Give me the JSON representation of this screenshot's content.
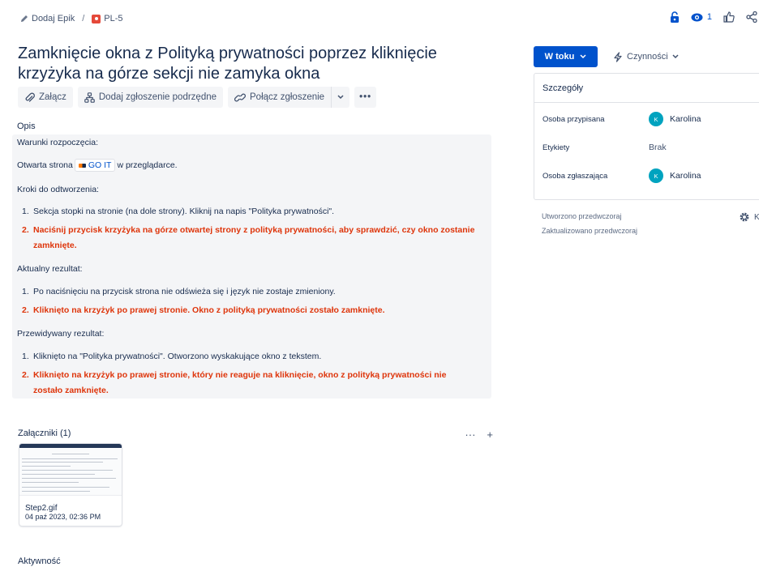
{
  "breadcrumb": {
    "epic_label": "Dodaj Epik",
    "separator": "/",
    "issue_key": "PL-5"
  },
  "header": {
    "watch_count": "1"
  },
  "issue": {
    "title": "Zamknięcie okna z Polityką prywatności poprzez kliknięcie krzyżyka na górze sekcji nie zamyka okna"
  },
  "toolbar": {
    "attach": "Załącz",
    "add_child": "Dodaj zgłoszenie podrzędne",
    "link_issue": "Połącz zgłoszenie",
    "more": "•••"
  },
  "description": {
    "label": "Opis",
    "preconditions_heading": "Warunki rozpoczęcia:",
    "open_page_before": "Otwarta strona",
    "goit_link": "GO IT",
    "open_page_after": "w przeglądarce.",
    "steps_heading": "Kroki do odtworzenia:",
    "steps": [
      {
        "num": "1.",
        "text": "Sekcja stopki na stronie (na dole strony). Kliknij na napis \"Polityka prywatności\"."
      },
      {
        "num": "2.",
        "text": "Naciśnij przycisk krzyżyka na górze otwartej strony z polityką prywatności, aby sprawdzić, czy okno zostanie zamknięte."
      }
    ],
    "actual_heading": "Aktualny rezultat:",
    "actual": [
      {
        "num": "1.",
        "text": "Po naciśnięciu na przycisk strona nie odświeża się i język nie zostaje zmieniony."
      },
      {
        "num": "2.",
        "text": "Kliknięto na krzyżyk po prawej stronie. Okno z polityką prywatności zostało zamknięte."
      }
    ],
    "expected_heading": "Przewidywany rezultat:",
    "expected": [
      {
        "num": "1.",
        "text": "Kliknięto na \"Polityka prywatności\". Otworzono wyskakujące okno z tekstem."
      },
      {
        "num": "2.",
        "text": "Kliknięto na krzyżyk po prawej stronie, który nie reaguje na kliknięcie, okno z polityką prywatności nie zostało zamknięte."
      }
    ]
  },
  "attachments": {
    "label": "Załączniki (1)",
    "more": "···",
    "add": "+",
    "file_name": "Step2.gif",
    "file_date": "04 paź 2023, 02:36 PM"
  },
  "activity": {
    "label": "Aktywność"
  },
  "sidebar": {
    "status": "W toku",
    "actions": "Czynności",
    "details_title": "Szczegóły",
    "assignee_label": "Osoba przypisana",
    "assignee_name": "Karolina",
    "assignee_initial": "K",
    "labels_label": "Etykiety",
    "labels_value": "Brak",
    "reporter_label": "Osoba zgłaszająca",
    "reporter_name": "Karolina",
    "reporter_initial": "K",
    "created": "Utworzono przedwczoraj",
    "updated": "Zaktualizowano przedwczoraj",
    "configure": "K"
  },
  "colors": {
    "primary": "#0052cc",
    "highlight_red": "#de350b",
    "avatar": "#00a3bf"
  }
}
